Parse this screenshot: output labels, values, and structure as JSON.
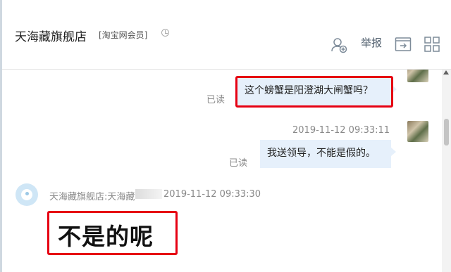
{
  "header": {
    "shop_name": "天海藏旗舰店",
    "member_tag": "[淘宝网会员]",
    "report_label": "举报"
  },
  "messages": [
    {
      "read_status": "已读",
      "text": "这个螃蟹是阳澄湖大闸蟹吗？"
    },
    {
      "timestamp": "2019-11-12 09:33:11",
      "read_status": "已读",
      "text": "我送领导，不能是假的。"
    },
    {
      "sender": "天海藏旗舰店:天海藏",
      "timestamp": "2019-11-12 09:33:30",
      "text": "不是的呢"
    }
  ],
  "icons": {
    "clock": "clock-icon",
    "add_contact": "add-contact-icon",
    "file_transfer": "file-transfer-icon",
    "apps": "apps-grid-icon"
  },
  "colors": {
    "highlight_border": "#e60012",
    "bubble_bg": "#e6f0fb"
  }
}
